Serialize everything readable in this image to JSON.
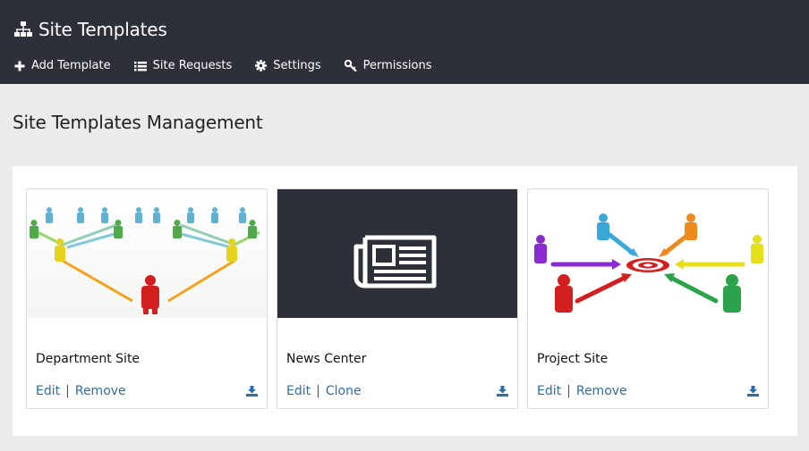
{
  "header": {
    "title": "Site Templates",
    "title_icon": "sitemap-icon",
    "nav": [
      {
        "label": "Add Template",
        "icon": "plus-icon"
      },
      {
        "label": "Site Requests",
        "icon": "list-icon"
      },
      {
        "label": "Settings",
        "icon": "gear-icon"
      },
      {
        "label": "Permissions",
        "icon": "key-icon"
      }
    ]
  },
  "main": {
    "page_title": "Site Templates Management",
    "cards": [
      {
        "name": "Department Site",
        "actions": [
          "Edit",
          "Remove"
        ],
        "thumb": "hierarchy-people-image"
      },
      {
        "name": "News Center",
        "actions": [
          "Edit",
          "Clone"
        ],
        "thumb": "newspaper-icon"
      },
      {
        "name": "Project Site",
        "actions": [
          "Edit",
          "Remove"
        ],
        "thumb": "target-arrows-image"
      }
    ]
  },
  "colors": {
    "header_bg": "#2d3038",
    "page_bg": "#ebebeb",
    "link": "#2f6da4",
    "download_icon": "#2f6da4"
  }
}
